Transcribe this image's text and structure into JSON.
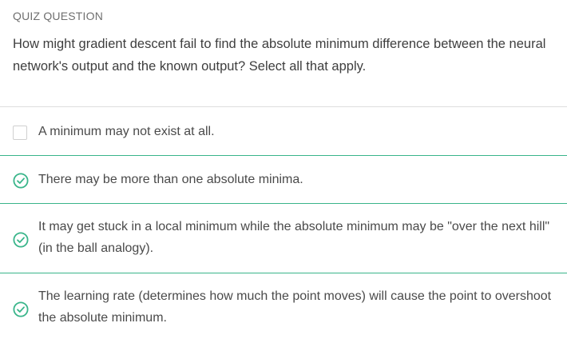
{
  "quiz": {
    "label": "QUIZ QUESTION",
    "question": "How might gradient descent fail to find the absolute minimum difference between the neural network's output and the known output? Select all that apply.",
    "accent_color": "#39b58a",
    "options": [
      {
        "text": "A minimum may not exist at all.",
        "state": "unchecked",
        "icon": "checkbox-empty"
      },
      {
        "text": "There may be more than one absolute minima.",
        "state": "correct",
        "icon": "check-circle-icon"
      },
      {
        "text": "It may get stuck in a local minimum while the absolute minimum may be \"over the next hill\" (in the ball analogy).",
        "state": "correct",
        "icon": "check-circle-icon"
      },
      {
        "text": "The learning rate (determines how much the point moves) will cause the point to overshoot the absolute minimum.",
        "state": "correct",
        "icon": "check-circle-icon"
      }
    ]
  }
}
